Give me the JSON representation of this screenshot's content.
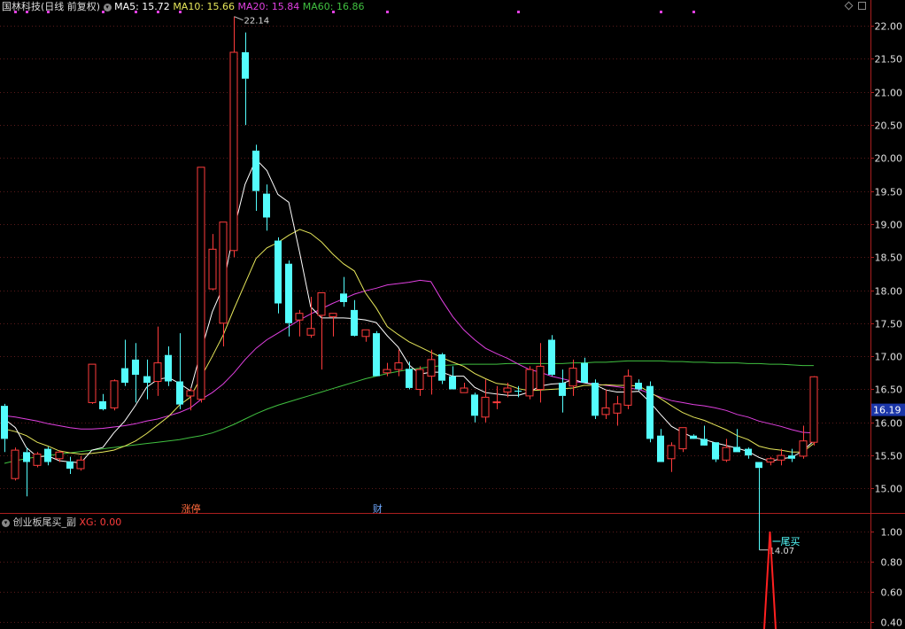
{
  "header": {
    "stock_title": "国林科技(日线 前复权)",
    "ma5": "MA5: 15.72",
    "ma10": "MA10: 15.66",
    "ma20": "MA20: 15.84",
    "ma60": "MA60: 16.86"
  },
  "sub_header": {
    "indicator_name": "创业板尾买_副",
    "xg_value": "XG: 0.00"
  },
  "colors": {
    "up": "#ff3c3c",
    "down": "#54fcfc",
    "ma5": "#ffffff",
    "ma10": "#e6e65a",
    "ma20": "#e040e0",
    "ma60": "#40c040",
    "axis_border": "#aa1e1e",
    "price_tag_bg": "#1b36a8",
    "signal": "#ff2020"
  },
  "chart_data": [
    {
      "type": "candlestick",
      "y_ticks": [
        "22.00",
        "21.50",
        "21.00",
        "20.50",
        "20.00",
        "19.50",
        "19.00",
        "18.50",
        "18.00",
        "17.50",
        "17.00",
        "16.50",
        "16.00",
        "15.50",
        "15.00"
      ],
      "ylim": [
        14.67,
        22.27
      ],
      "current_price": "16.19",
      "annotations": {
        "high": "22.14",
        "low": "14.07",
        "limit_up": "涨停",
        "finance": "财"
      },
      "candles": [
        [
          16.25,
          16.28,
          15.55,
          15.75
        ],
        [
          15.15,
          15.62,
          15.12,
          15.58
        ],
        [
          15.55,
          15.62,
          14.88,
          15.4
        ],
        [
          15.35,
          15.55,
          15.32,
          15.52
        ],
        [
          15.6,
          15.63,
          15.35,
          15.4
        ],
        [
          15.45,
          15.58,
          15.4,
          15.55
        ],
        [
          15.41,
          15.48,
          15.22,
          15.3
        ],
        [
          15.3,
          15.49,
          15.27,
          15.43
        ],
        [
          16.3,
          16.88,
          16.28,
          16.88
        ],
        [
          16.32,
          16.43,
          16.18,
          16.2
        ],
        [
          16.22,
          16.65,
          16.18,
          16.63
        ],
        [
          16.82,
          17.25,
          16.55,
          16.6
        ],
        [
          16.95,
          17.2,
          16.3,
          16.72
        ],
        [
          16.7,
          16.95,
          16.35,
          16.6
        ],
        [
          16.62,
          17.45,
          16.4,
          16.9
        ],
        [
          17.02,
          17.15,
          16.55,
          16.62
        ],
        [
          16.62,
          17.35,
          16.2,
          16.27
        ],
        [
          16.4,
          16.52,
          16.18,
          16.48
        ],
        [
          16.35,
          19.86,
          16.3,
          19.86
        ],
        [
          18.02,
          18.85,
          18.0,
          18.62
        ],
        [
          17.5,
          19.0,
          17.15,
          19.03
        ],
        [
          18.6,
          22.14,
          18.5,
          21.6
        ],
        [
          21.6,
          21.9,
          20.5,
          21.2
        ],
        [
          20.11,
          20.2,
          19.2,
          19.5
        ],
        [
          19.46,
          19.6,
          18.9,
          19.1
        ],
        [
          18.75,
          18.8,
          17.65,
          17.8
        ],
        [
          18.4,
          18.45,
          17.3,
          17.5
        ],
        [
          17.55,
          17.7,
          17.3,
          17.65
        ],
        [
          17.32,
          17.9,
          17.28,
          17.42
        ],
        [
          17.62,
          17.88,
          16.8,
          17.96
        ],
        [
          17.6,
          17.63,
          17.3,
          17.65
        ],
        [
          17.95,
          18.2,
          17.75,
          17.82
        ],
        [
          17.7,
          17.85,
          17.3,
          17.31
        ],
        [
          17.3,
          17.4,
          17.22,
          17.4
        ],
        [
          17.35,
          17.38,
          16.7,
          16.7
        ],
        [
          16.75,
          16.9,
          16.7,
          16.8
        ],
        [
          16.8,
          17.1,
          16.7,
          16.9
        ],
        [
          16.81,
          16.92,
          16.5,
          16.52
        ],
        [
          16.5,
          16.85,
          16.4,
          16.8
        ],
        [
          16.7,
          17.1,
          16.42,
          16.95
        ],
        [
          17.03,
          17.05,
          16.58,
          16.63
        ],
        [
          16.7,
          16.85,
          16.52,
          16.5
        ],
        [
          16.45,
          16.6,
          16.45,
          16.52
        ],
        [
          16.42,
          16.45,
          16.0,
          16.1
        ],
        [
          16.08,
          16.65,
          16.0,
          16.38
        ],
        [
          16.3,
          16.55,
          16.2,
          16.31
        ],
        [
          16.46,
          16.6,
          16.38,
          16.52
        ],
        [
          16.48,
          16.55,
          16.38,
          16.47
        ],
        [
          16.4,
          16.85,
          16.35,
          16.8
        ],
        [
          16.5,
          17.2,
          16.3,
          16.85
        ],
        [
          17.25,
          17.32,
          16.7,
          16.72
        ],
        [
          16.6,
          16.8,
          16.15,
          16.4
        ],
        [
          16.55,
          16.95,
          16.4,
          16.82
        ],
        [
          16.9,
          16.98,
          16.75,
          16.6
        ],
        [
          16.6,
          16.65,
          16.05,
          16.1
        ],
        [
          16.12,
          16.5,
          16.05,
          16.22
        ],
        [
          16.14,
          16.4,
          15.95,
          16.28
        ],
        [
          16.26,
          16.8,
          16.2,
          16.7
        ],
        [
          16.6,
          16.65,
          16.48,
          16.5
        ],
        [
          16.55,
          16.62,
          15.7,
          15.75
        ],
        [
          15.8,
          15.9,
          15.4,
          15.4
        ],
        [
          15.45,
          15.7,
          15.25,
          15.65
        ],
        [
          15.6,
          15.9,
          15.55,
          15.92
        ],
        [
          15.8,
          15.82,
          15.76,
          15.75
        ],
        [
          15.75,
          15.95,
          15.7,
          15.65
        ],
        [
          15.7,
          15.7,
          15.4,
          15.44
        ],
        [
          15.43,
          15.75,
          15.4,
          15.62
        ],
        [
          15.63,
          15.9,
          15.55,
          15.55
        ],
        [
          15.6,
          15.62,
          15.45,
          15.5
        ],
        [
          15.4,
          15.4,
          14.07,
          15.31
        ],
        [
          15.4,
          15.48,
          15.35,
          15.45
        ],
        [
          15.43,
          15.6,
          15.35,
          15.5
        ],
        [
          15.5,
          15.6,
          15.4,
          15.45
        ],
        [
          15.49,
          15.95,
          15.45,
          15.72
        ],
        [
          15.7,
          16.7,
          15.65,
          16.69
        ]
      ],
      "ma5": [
        16.05,
        15.92,
        15.62,
        15.48,
        15.49,
        15.42,
        15.4,
        15.39,
        15.58,
        15.62,
        15.84,
        16.02,
        16.26,
        16.53,
        16.65,
        16.68,
        16.59,
        16.48,
        17.09,
        17.67,
        18.05,
        18.92,
        19.6,
        19.98,
        19.81,
        19.45,
        19.33,
        18.57,
        17.75,
        17.58,
        17.58,
        17.58,
        17.57,
        17.55,
        17.51,
        17.31,
        17.14,
        16.87,
        16.73,
        16.76,
        16.76,
        16.7,
        16.7,
        16.53,
        16.45,
        16.43,
        16.41,
        16.41,
        16.46,
        16.55,
        16.58,
        16.59,
        16.65,
        16.6,
        16.57,
        16.49,
        16.46,
        16.46,
        16.47,
        16.31,
        16.12,
        15.94,
        15.85,
        15.77,
        15.74,
        15.69,
        15.65,
        15.61,
        15.56,
        15.47,
        15.41,
        15.45,
        15.47,
        15.57,
        15.72
      ],
      "ma10": [
        15.9,
        15.86,
        15.8,
        15.7,
        15.64,
        15.57,
        15.54,
        15.52,
        15.53,
        15.55,
        15.58,
        15.64,
        15.72,
        15.83,
        15.96,
        16.09,
        16.26,
        16.38,
        16.69,
        17.0,
        17.32,
        17.72,
        18.1,
        18.48,
        18.64,
        18.72,
        18.83,
        18.92,
        18.86,
        18.73,
        18.55,
        18.4,
        18.29,
        17.96,
        17.73,
        17.45,
        17.33,
        17.22,
        17.14,
        17.06,
        16.98,
        16.91,
        16.85,
        16.74,
        16.66,
        16.59,
        16.57,
        16.51,
        16.48,
        16.49,
        16.5,
        16.51,
        16.52,
        16.56,
        16.56,
        16.57,
        16.56,
        16.56,
        16.55,
        16.46,
        16.36,
        16.25,
        16.15,
        16.08,
        16.03,
        15.96,
        15.89,
        15.8,
        15.74,
        15.64,
        15.6,
        15.58,
        15.55,
        15.55,
        15.68
      ],
      "ma20": [
        16.1,
        16.08,
        16.05,
        16.02,
        15.98,
        15.95,
        15.92,
        15.9,
        15.9,
        15.91,
        15.93,
        15.95,
        15.98,
        16.02,
        16.05,
        16.1,
        16.15,
        16.22,
        16.35,
        16.45,
        16.58,
        16.75,
        16.95,
        17.12,
        17.25,
        17.35,
        17.45,
        17.55,
        17.64,
        17.72,
        17.8,
        17.87,
        17.94,
        17.99,
        18.03,
        18.08,
        18.1,
        18.12,
        18.15,
        18.13,
        17.85,
        17.6,
        17.4,
        17.25,
        17.12,
        17.04,
        16.97,
        16.88,
        16.8,
        16.76,
        16.7,
        16.66,
        16.62,
        16.6,
        16.58,
        16.56,
        16.54,
        16.52,
        16.5,
        16.44,
        16.38,
        16.33,
        16.3,
        16.27,
        16.25,
        16.22,
        16.18,
        16.12,
        16.08,
        16.02,
        15.98,
        15.94,
        15.89,
        15.85,
        15.84
      ],
      "ma60": [
        15.38,
        15.42,
        15.45,
        15.48,
        15.5,
        15.52,
        15.54,
        15.56,
        15.58,
        15.6,
        15.62,
        15.64,
        15.66,
        15.68,
        15.7,
        15.72,
        15.74,
        15.77,
        15.8,
        15.84,
        15.9,
        15.97,
        16.05,
        16.13,
        16.2,
        16.26,
        16.31,
        16.36,
        16.41,
        16.46,
        16.51,
        16.56,
        16.61,
        16.66,
        16.7,
        16.74,
        16.77,
        16.8,
        16.82,
        16.84,
        16.86,
        16.87,
        16.88,
        16.88,
        16.88,
        16.88,
        16.89,
        16.89,
        16.89,
        16.89,
        16.89,
        16.89,
        16.9,
        16.9,
        16.91,
        16.91,
        16.92,
        16.93,
        16.93,
        16.93,
        16.93,
        16.92,
        16.92,
        16.91,
        16.91,
        16.9,
        16.9,
        16.9,
        16.89,
        16.89,
        16.88,
        16.88,
        16.87,
        16.86,
        16.86
      ]
    },
    {
      "type": "line",
      "y_ticks": [
        "1.00",
        "0.80",
        "0.60",
        "0.40"
      ],
      "ylim": [
        0.35,
        1.0
      ],
      "signal_index": 70,
      "signal_label": "尾买"
    }
  ],
  "top_dot_indices": [
    1,
    2,
    4,
    9,
    12,
    14,
    16,
    30,
    35,
    47,
    60,
    63
  ]
}
